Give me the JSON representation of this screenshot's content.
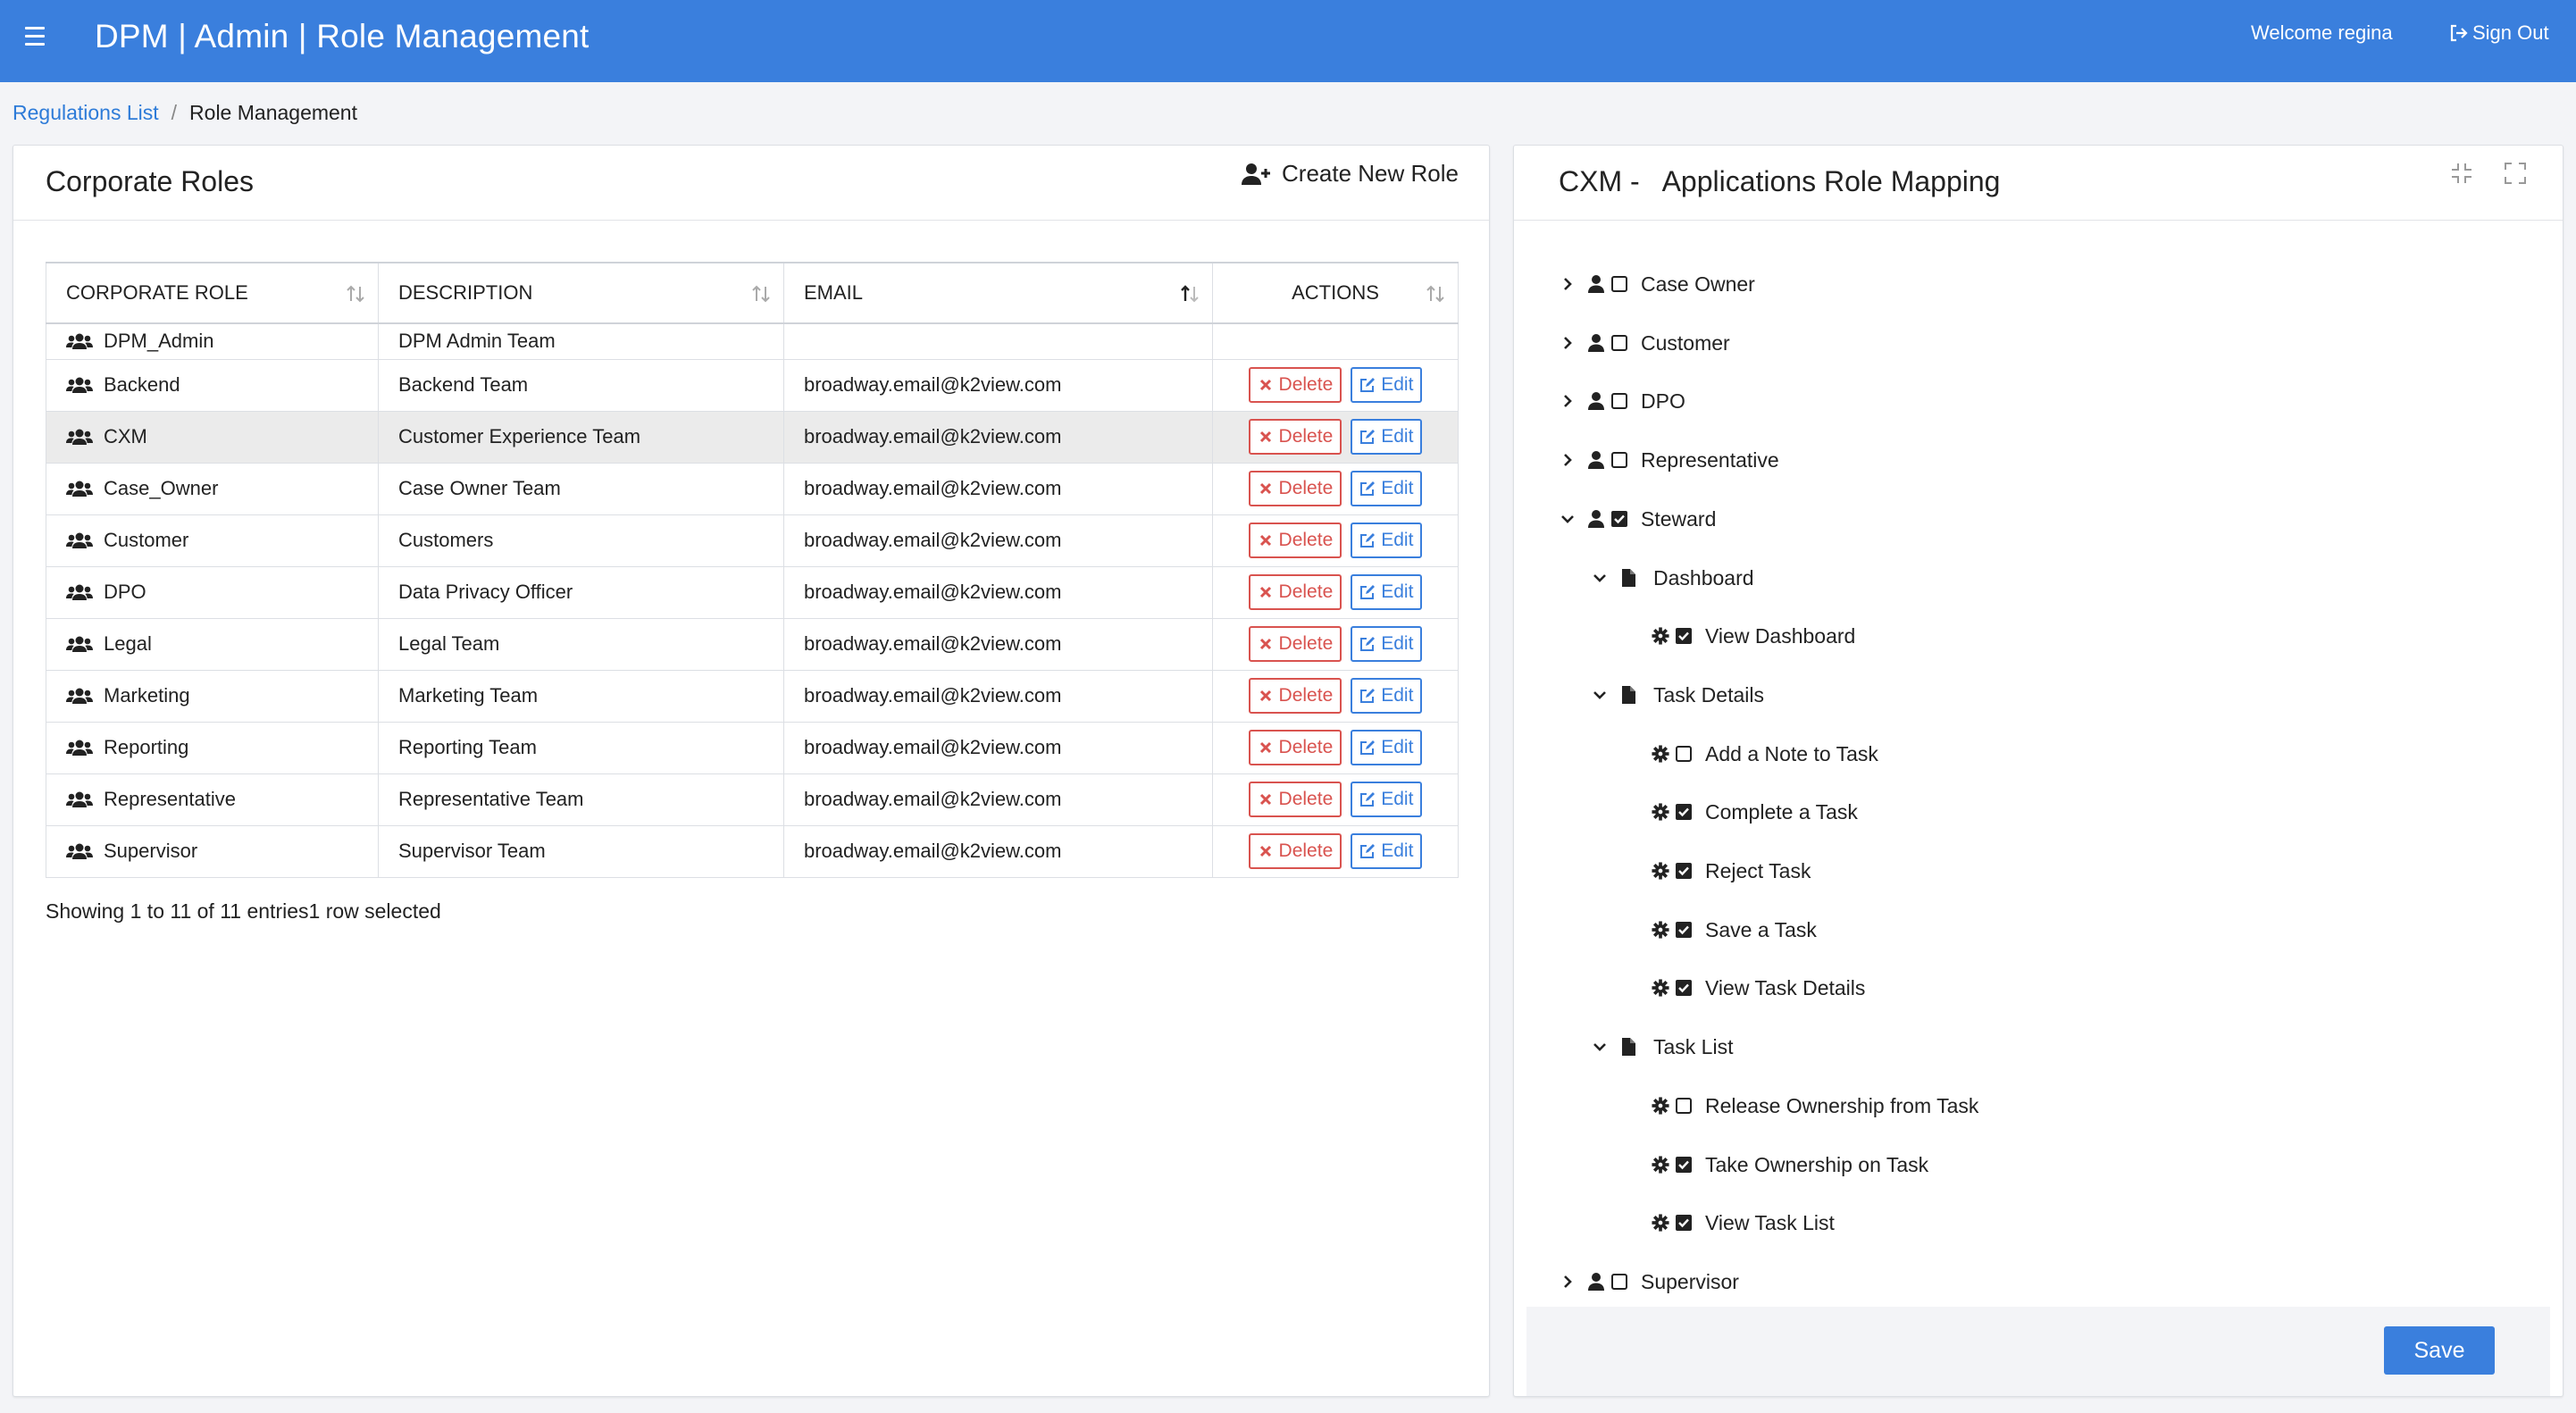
{
  "header": {
    "title": "DPM | Admin | Role Management",
    "welcome": "Welcome regina",
    "sign_out": "Sign Out"
  },
  "breadcrumb": {
    "link": "Regulations List",
    "separator": "/",
    "current": "Role Management"
  },
  "roles_panel": {
    "title": "Corporate Roles",
    "create_label": "Create New Role",
    "columns": [
      "CORPORATE ROLE",
      "DESCRIPTION",
      "EMAIL",
      "ACTIONS"
    ],
    "delete_label": "Delete",
    "edit_label": "Edit",
    "rows": [
      {
        "role": "DPM_Admin",
        "description": "DPM Admin Team",
        "email": "",
        "actions": false
      },
      {
        "role": "Backend",
        "description": "Backend Team",
        "email": "broadway.email@k2view.com",
        "actions": true
      },
      {
        "role": "CXM",
        "description": "Customer Experience Team",
        "email": "broadway.email@k2view.com",
        "actions": true,
        "selected": true
      },
      {
        "role": "Case_Owner",
        "description": "Case Owner Team",
        "email": "broadway.email@k2view.com",
        "actions": true
      },
      {
        "role": "Customer",
        "description": "Customers",
        "email": "broadway.email@k2view.com",
        "actions": true
      },
      {
        "role": "DPO",
        "description": "Data Privacy Officer",
        "email": "broadway.email@k2view.com",
        "actions": true
      },
      {
        "role": "Legal",
        "description": "Legal Team",
        "email": "broadway.email@k2view.com",
        "actions": true
      },
      {
        "role": "Marketing",
        "description": "Marketing Team",
        "email": "broadway.email@k2view.com",
        "actions": true
      },
      {
        "role": "Reporting",
        "description": "Reporting Team",
        "email": "broadway.email@k2view.com",
        "actions": true
      },
      {
        "role": "Representative",
        "description": "Representative Team",
        "email": "broadway.email@k2view.com",
        "actions": true
      },
      {
        "role": "Supervisor",
        "description": "Supervisor Team",
        "email": "broadway.email@k2view.com",
        "actions": true
      }
    ],
    "info": "Showing 1 to 11 of 11 entries1 row selected"
  },
  "mapping_panel": {
    "title": "CXM -   Applications Role Mapping",
    "save_label": "Save",
    "tree": [
      {
        "label": "Case Owner",
        "level": 0,
        "icon": "user-icon",
        "chevron": "right",
        "checked": false
      },
      {
        "label": "Customer",
        "level": 0,
        "icon": "user-icon",
        "chevron": "right",
        "checked": false
      },
      {
        "label": "DPO",
        "level": 0,
        "icon": "user-icon",
        "chevron": "right",
        "checked": false
      },
      {
        "label": "Representative",
        "level": 0,
        "icon": "user-icon",
        "chevron": "right",
        "checked": false
      },
      {
        "label": "Steward",
        "level": 0,
        "icon": "user-icon",
        "chevron": "down",
        "checked": true
      },
      {
        "label": "Dashboard",
        "level": 1,
        "icon": "file-icon",
        "chevron": "down"
      },
      {
        "label": "View Dashboard",
        "level": 2,
        "icon": "gear-icon",
        "checked": true
      },
      {
        "label": "Task Details",
        "level": 1,
        "icon": "file-icon",
        "chevron": "down"
      },
      {
        "label": "Add a Note to Task",
        "level": 2,
        "icon": "gear-icon",
        "checked": false
      },
      {
        "label": "Complete a Task",
        "level": 2,
        "icon": "gear-icon",
        "checked": true
      },
      {
        "label": "Reject Task",
        "level": 2,
        "icon": "gear-icon",
        "checked": true
      },
      {
        "label": "Save a Task",
        "level": 2,
        "icon": "gear-icon",
        "checked": true
      },
      {
        "label": "View Task Details",
        "level": 2,
        "icon": "gear-icon",
        "checked": true
      },
      {
        "label": "Task List",
        "level": 1,
        "icon": "file-icon",
        "chevron": "down"
      },
      {
        "label": "Release Ownership from Task",
        "level": 2,
        "icon": "gear-icon",
        "checked": false
      },
      {
        "label": "Take Ownership on Task",
        "level": 2,
        "icon": "gear-icon",
        "checked": true
      },
      {
        "label": "View Task List",
        "level": 2,
        "icon": "gear-icon",
        "checked": true
      },
      {
        "label": "Supervisor",
        "level": 0,
        "icon": "user-icon",
        "chevron": "right",
        "checked": false
      }
    ]
  },
  "colors": {
    "primary": "#3a7fdd",
    "danger": "#d9534f",
    "background": "#f3f4f7",
    "selected_row": "#ebebeb"
  }
}
